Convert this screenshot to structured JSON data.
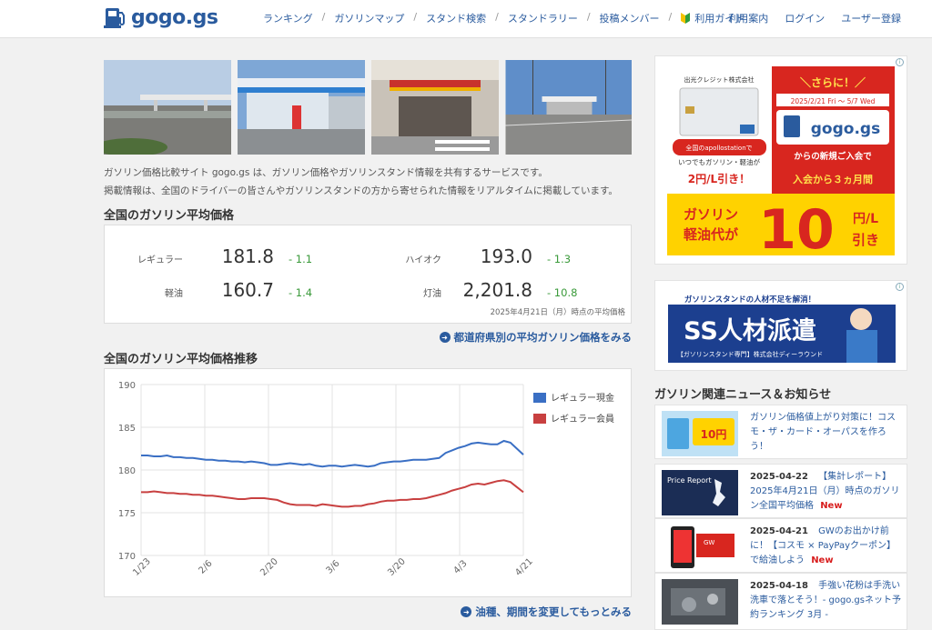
{
  "header": {
    "logo": "gogo.gs",
    "nav": [
      "ランキング",
      "ガソリンマップ",
      "スタンド検索",
      "スタンドラリー",
      "投稿メンバー",
      "利用ガイド"
    ],
    "user_nav": [
      "利用案内",
      "ログイン",
      "ユーザー登録"
    ]
  },
  "intro": {
    "line1": "ガソリン価格比較サイト gogo.gs は、ガソリン価格やガソリンスタンド情報を共有するサービスです。",
    "line2": "掲載情報は、全国のドライバーの皆さんやガソリンスタンドの方から寄せられた情報をリアルタイムに掲載しています。"
  },
  "avg_price": {
    "title": "全国のガソリン平均価格",
    "items": [
      {
        "label": "レギュラー",
        "value": "181.8",
        "change": "- 1.1"
      },
      {
        "label": "ハイオク",
        "value": "193.0",
        "change": "- 1.3"
      },
      {
        "label": "軽油",
        "value": "160.7",
        "change": "- 1.4"
      },
      {
        "label": "灯油",
        "value": "2,201.8",
        "change": "- 10.8"
      }
    ],
    "note": "2025年4月21日（月）時点の平均価格",
    "link": "都道府県別の平均ガソリン価格をみる"
  },
  "trend": {
    "title": "全国のガソリン平均価格推移",
    "link": "油種、期間を変更してもっとみる"
  },
  "chart_data": {
    "type": "line",
    "ylim": [
      170,
      190
    ],
    "yticks": [
      170,
      175,
      180,
      185,
      190
    ],
    "xticks": [
      "1/23",
      "2/6",
      "2/20",
      "3/6",
      "3/20",
      "4/3",
      "4/21"
    ],
    "legend_position": "top-right",
    "series": [
      {
        "name": "レギュラー現金",
        "color": "#3a6fc4",
        "values": [
          181.7,
          181.7,
          181.6,
          181.6,
          181.7,
          181.5,
          181.5,
          181.4,
          181.4,
          181.3,
          181.2,
          181.2,
          181.1,
          181.1,
          181.0,
          181.0,
          180.9,
          181.0,
          180.9,
          180.8,
          180.6,
          180.6,
          180.7,
          180.8,
          180.7,
          180.6,
          180.7,
          180.5,
          180.4,
          180.5,
          180.5,
          180.4,
          180.5,
          180.6,
          180.5,
          180.4,
          180.5,
          180.8,
          180.9,
          181.0,
          181.0,
          181.1,
          181.2,
          181.2,
          181.2,
          181.3,
          181.4,
          182.0,
          182.3,
          182.6,
          182.8,
          183.1,
          183.2,
          183.1,
          183.0,
          183.0,
          183.4,
          183.2,
          182.5,
          181.8
        ]
      },
      {
        "name": "レギュラー会員",
        "color": "#c84040",
        "values": [
          177.4,
          177.4,
          177.5,
          177.4,
          177.3,
          177.3,
          177.2,
          177.2,
          177.1,
          177.1,
          177.0,
          177.0,
          176.9,
          176.8,
          176.7,
          176.6,
          176.6,
          176.7,
          176.7,
          176.7,
          176.6,
          176.5,
          176.2,
          176.0,
          175.9,
          175.9,
          175.9,
          175.8,
          176.0,
          175.9,
          175.8,
          175.7,
          175.7,
          175.8,
          175.8,
          176.0,
          176.1,
          176.3,
          176.4,
          176.4,
          176.5,
          176.5,
          176.6,
          176.6,
          176.7,
          176.9,
          177.1,
          177.3,
          177.6,
          177.8,
          178.0,
          178.3,
          178.4,
          178.3,
          178.5,
          178.7,
          178.8,
          178.6,
          178.0,
          177.4
        ]
      }
    ]
  },
  "ads": {
    "ad1": {
      "issuer": "出光クレジット株式会社",
      "bubble_a": "全国のapollostationで",
      "bubble_b": "いつでもガソリン・軽油が",
      "bubble_c": "2円/L引き！",
      "sarani": "＼さらに！／",
      "period": "2025/2/21 Fri ～ 5/7 Wed",
      "brand": "gogo.gs",
      "from": "からの新規ご入会で",
      "months": "入会から３ヵ月間",
      "bottom_left": "ガソリン",
      "bottom_left2": "軽油代が",
      "big": "10",
      "unit": "円/L",
      "unit2": "引き"
    },
    "ad2": {
      "top": "ガソリンスタンドの人材不足を解消！",
      "main": "SS人材派遣",
      "sub": "【ガソリンスタンド専門】株式会社ディーラウンド"
    }
  },
  "news": {
    "title": "ガソリン関連ニュース＆お知らせ",
    "items": [
      {
        "date": "",
        "text": "ガソリン価格値上がり対策に！コスモ・ザ・カード・オーパスを作ろう！",
        "new": ""
      },
      {
        "date": "2025-04-22",
        "text": "【集計レポート】2025年4月21日（月）時点のガソリン全国平均価格",
        "new": "New"
      },
      {
        "date": "2025-04-21",
        "text": "GWのお出かけ前に！【コスモ × PayPayクーポン】で給油しよう",
        "new": "New"
      },
      {
        "date": "2025-04-18",
        "text": "手強い花粉は手洗い洗車で落とそう！- gogo.gsネット予約ランキング 3月 -",
        "new": ""
      }
    ],
    "thumb_texts": [
      "Price Report",
      "GW",
      "10円"
    ]
  },
  "colors": {
    "brand": "#2a5b9e",
    "positive_change": "#3a9a3a",
    "new": "#d81e1e"
  }
}
